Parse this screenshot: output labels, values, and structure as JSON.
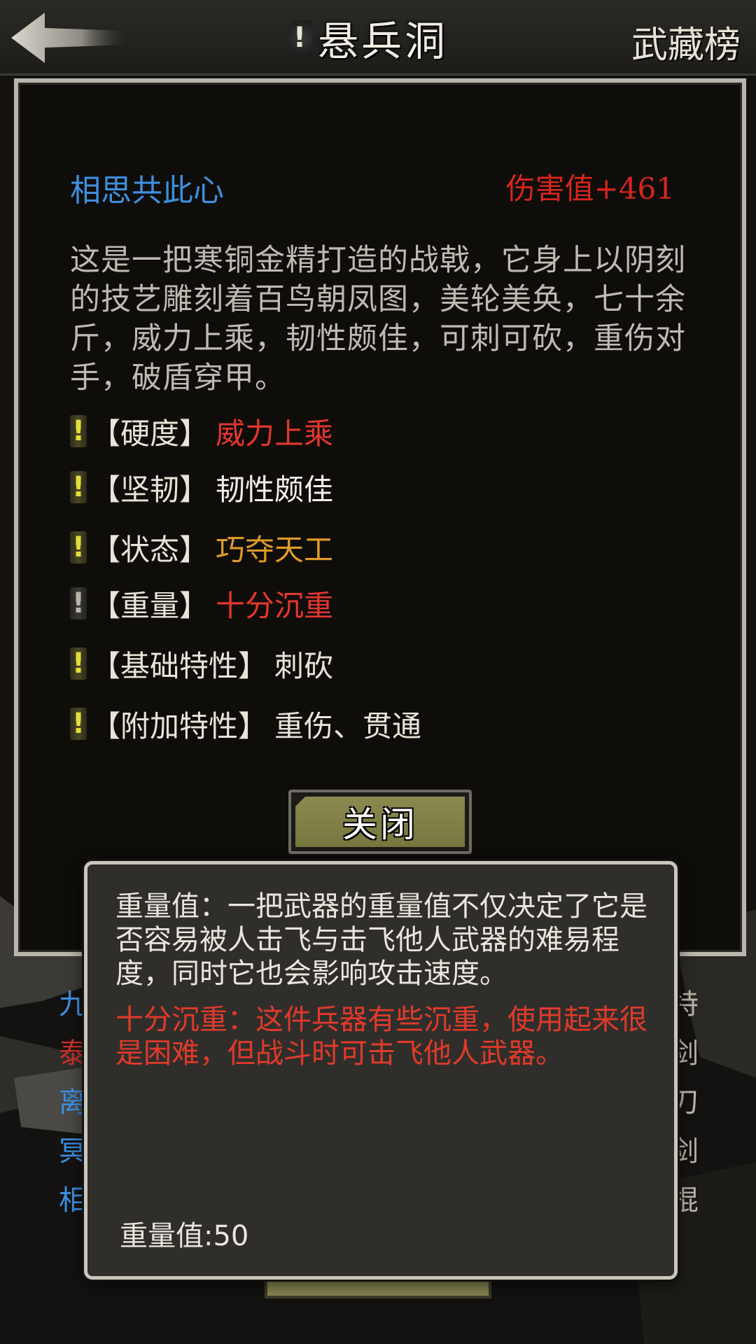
{
  "header": {
    "title_tip_icon": "!",
    "title": "悬兵洞",
    "ranking_link": "武藏榜"
  },
  "weapon": {
    "name": "相思共此心",
    "damage": "伤害值+461",
    "description": "这是一把寒铜金精打造的战戟，它身上以阴刻的技艺雕刻着百鸟朝凤图，美轮美奂，七十余斤，威力上乘，韧性颇佳，可刺可砍，重伤对手，破盾穿甲。",
    "properties": [
      {
        "icon": "!",
        "label": "【硬度】",
        "value": "威力上乘",
        "value_color": "#e5362e",
        "icon_color": "yellow"
      },
      {
        "icon": "!",
        "label": "【坚韧】",
        "value": "韧性颇佳",
        "value_color": "#f2efe6",
        "icon_color": "yellow"
      },
      {
        "icon": "!",
        "label": "【状态】",
        "value": "巧夺天工",
        "value_color": "#e09a2a",
        "icon_color": "yellow"
      },
      {
        "icon": "!",
        "label": "【重量】",
        "value": "十分沉重",
        "value_color": "#e5362e",
        "icon_color": "gray"
      },
      {
        "icon": "!",
        "label": "【基础特性】",
        "value": "刺砍",
        "value_color": "#e8e4d8",
        "icon_color": "yellow"
      },
      {
        "icon": "!",
        "label": "【附加特性】",
        "value": "重伤、贯通",
        "value_color": "#e8e4d8",
        "icon_color": "yellow"
      }
    ]
  },
  "buttons": {
    "close": "关闭"
  },
  "tooltip": {
    "description": "重量值：一把武器的重量值不仅决定了它是否容易被人击飞与击飞他人武器的难易程度，同时它也会影响攻击速度。",
    "effect": "十分沉重：这件兵器有些沉重，使用起来很是困难，但战斗时可击飞他人武器。",
    "value_text": "重量值:50"
  },
  "background_list": {
    "left": [
      {
        "text": "九",
        "color": "#3d8fe0"
      },
      {
        "text": "泰",
        "color": "#c9302a"
      },
      {
        "text": "离",
        "color": "#3d8fe0"
      },
      {
        "text": "冥",
        "color": "#3d8fe0"
      },
      {
        "text": "相",
        "color": "#3d8fe0"
      }
    ],
    "right": [
      "特",
      "剑",
      "刀",
      "剑",
      "棍"
    ]
  },
  "icons": {
    "back": "back-arrow-icon",
    "info": "exclamation-icon"
  },
  "colors": {
    "name_blue": "#3d8fe0",
    "damage_red": "#d8251e",
    "warn_red": "#e03a2c",
    "button_olive": "#7f7f45"
  }
}
